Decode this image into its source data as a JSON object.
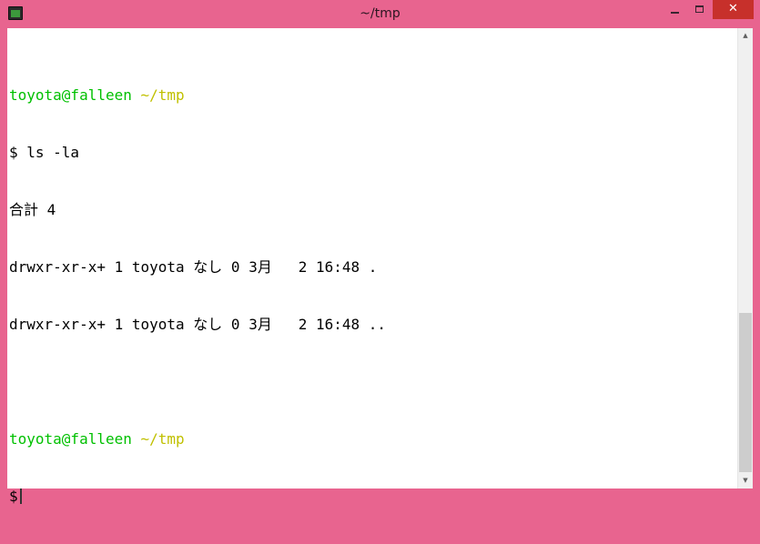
{
  "window": {
    "title": "~/tmp",
    "controls": {
      "minimize": "minimize-icon",
      "maximize": "maximize-icon",
      "close": "✕"
    }
  },
  "terminal": {
    "blank_line_1": "",
    "prompt1_user": "toyota@falleen",
    "prompt1_dir": "~/tmp",
    "command1": "$ ls -la",
    "output_total": "合計 4",
    "output_row1": "drwxr-xr-x+ 1 toyota なし 0 3月   2 16:48 .",
    "output_row2": "drwxr-xr-x+ 1 toyota なし 0 3月   2 16:48 ..",
    "blank_line_2": "",
    "prompt2_user": "toyota@falleen",
    "prompt2_dir": "~/tmp",
    "prompt2_symbol": "$"
  },
  "scrollbar": {
    "up_icon": "scroll-up-arrow-icon",
    "down_icon": "scroll-down-arrow-icon",
    "position_fraction": 1.0
  },
  "colors": {
    "frame": "#e8648f",
    "close_button": "#c7302b",
    "prompt_user": "#00c000",
    "prompt_dir": "#c0c000",
    "terminal_bg": "#ffffff",
    "terminal_fg": "#000000"
  }
}
